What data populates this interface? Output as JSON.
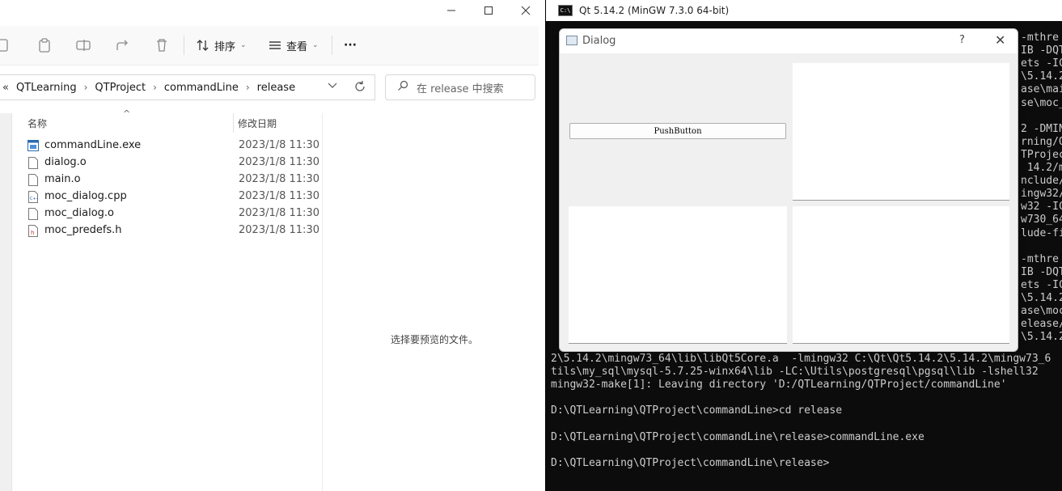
{
  "explorer": {
    "toolbar": {
      "sort_label": "排序",
      "view_label": "查看",
      "more_label": "···"
    },
    "address": {
      "overflow": "«",
      "segments": [
        "QTLearning",
        "QTProject",
        "commandLine",
        "release"
      ]
    },
    "search": {
      "placeholder": "在 release 中搜索"
    },
    "columns": {
      "name": "名称",
      "modified": "修改日期"
    },
    "files": [
      {
        "name": "commandLine.exe",
        "date": "2023/1/8 11:30",
        "type": "exe"
      },
      {
        "name": "dialog.o",
        "date": "2023/1/8 11:30",
        "type": "file"
      },
      {
        "name": "main.o",
        "date": "2023/1/8 11:30",
        "type": "file"
      },
      {
        "name": "moc_dialog.cpp",
        "date": "2023/1/8 11:30",
        "type": "cpp"
      },
      {
        "name": "moc_dialog.o",
        "date": "2023/1/8 11:30",
        "type": "file"
      },
      {
        "name": "moc_predefs.h",
        "date": "2023/1/8 11:30",
        "type": "h"
      }
    ],
    "preview_text": "选择要预览的文件。"
  },
  "console": {
    "title": "Qt 5.14.2 (MinGW 7.3.0 64-bit)",
    "lines": [
      "2\\5.14.2\\mingw73_64\\lib\\libQt5Core.a  -lmingw32 C:\\Qt\\Qt5.14.2\\5.14.2\\mingw73_6",
      "tils\\my_sql\\mysql-5.7.25-winx64\\lib -LC:\\Utils\\postgresql\\pgsql\\lib -lshell32",
      "mingw32-make[1]: Leaving directory 'D:/QTLearning/QTProject/commandLine'",
      "",
      "D:\\QTLearning\\QTProject\\commandLine>cd release",
      "",
      "D:\\QTLearning\\QTProject\\commandLine\\release>commandLine.exe",
      "",
      "D:\\QTLearning\\QTProject\\commandLine\\release>"
    ],
    "right_fragments": [
      "-mthre",
      "IB -DQT",
      "ets -IC",
      "\\5.14.2",
      "ase\\mai",
      "se\\moc_",
      "",
      "2 -DMIN",
      "rning/Q",
      "TProjec",
      " 14.2/m",
      "nclude/",
      "ingw32/",
      "w32 -IC",
      "w730_64",
      "lude-fi",
      "",
      "-mthre",
      "IB -DQT",
      "ets -IC",
      "\\5.14.2",
      "ase\\moc",
      "elease/",
      "\\5.14.2"
    ]
  },
  "dialog": {
    "title": "Dialog",
    "help_label": "?",
    "close_label": "✕",
    "button_label": "PushButton"
  }
}
